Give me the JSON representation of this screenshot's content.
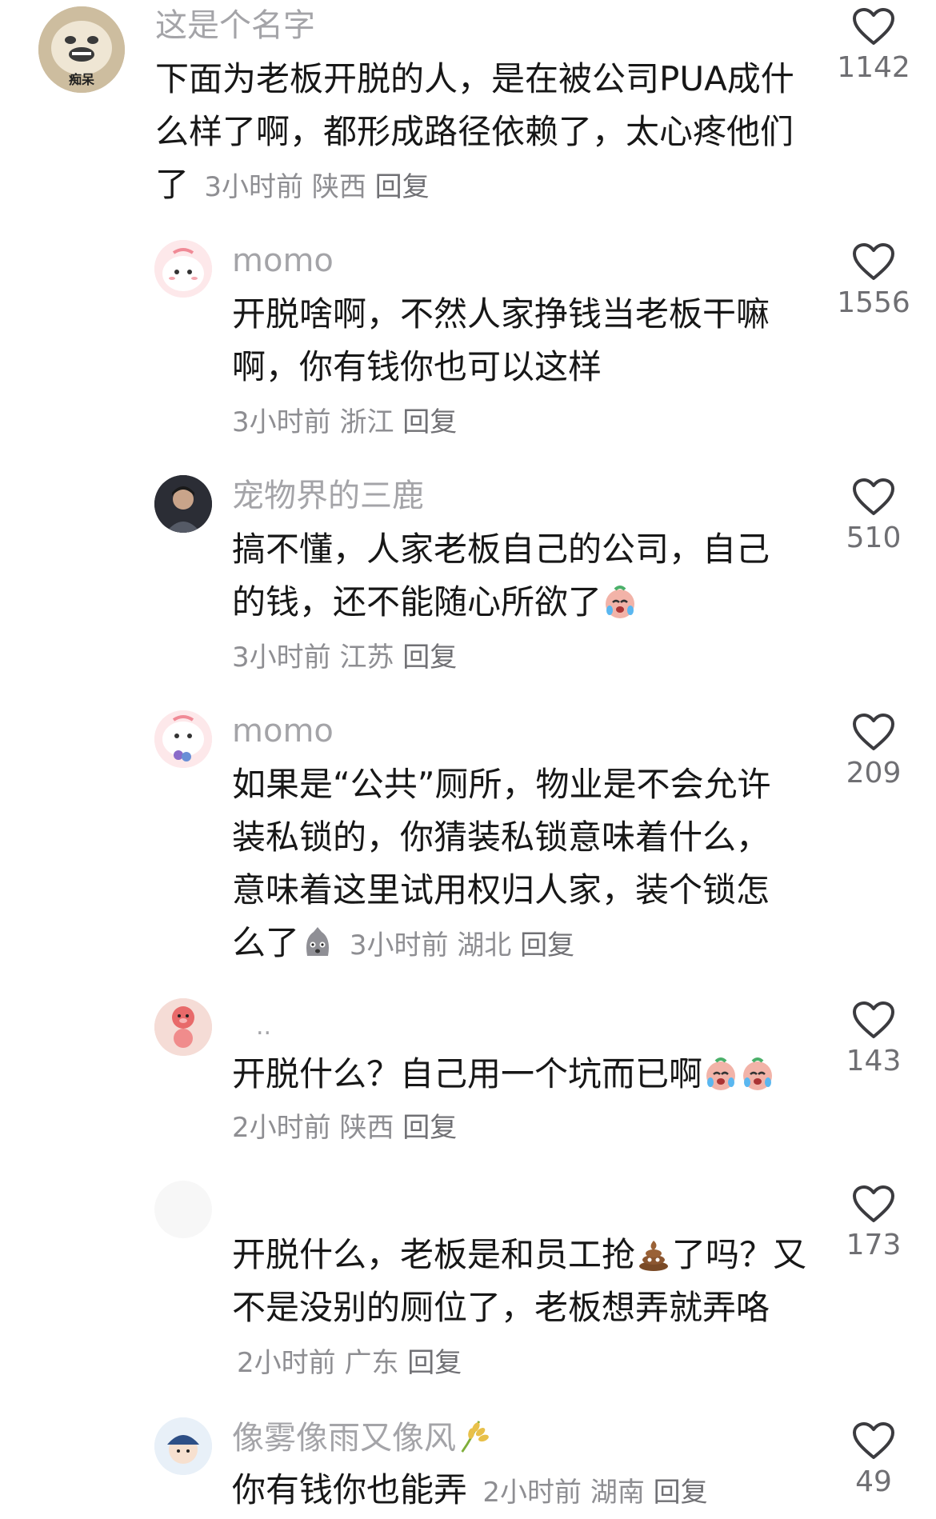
{
  "comments": [
    {
      "username": "这是个名字",
      "avatar_label": "痴呆",
      "text": "下面为老板开脱的人，是在被公司PUA成什么样了啊，都形成路径依赖了，太心疼他们了",
      "time": "3小时前",
      "location": "陕西",
      "reply": "回复",
      "likes": "1142"
    },
    {
      "username": "momo",
      "text": "开脱啥啊，不然人家挣钱当老板干嘛啊，你有钱你也可以这样",
      "time": "3小时前",
      "location": "浙江",
      "reply": "回复",
      "likes": "1556"
    },
    {
      "username": "宠物界的三鹿",
      "text": "搞不懂，人家老板自己的公司，自己的钱，还不能随心所欲了",
      "emoji": "crying-face",
      "time": "3小时前",
      "location": "江苏",
      "reply": "回复",
      "likes": "510"
    },
    {
      "username": "momo",
      "text": "如果是“公共”厕所，物业是不会允许装私锁的，你猜装私锁意味着什么，意味着这里试用权归人家，装个锁怎么了",
      "emoji": "sad-bag-face",
      "time": "3小时前",
      "location": "湖北",
      "reply": "回复",
      "likes": "209"
    },
    {
      "username": "..",
      "text": "开脱什么？自己用一个坑而已啊",
      "emoji": "crying-face x2",
      "time": "2小时前",
      "location": "陕西",
      "reply": "回复",
      "likes": "143"
    },
    {
      "username": "",
      "text_part1": "开脱什么，老板是和员工抢",
      "emoji": "poop",
      "text_part2": "了吗？又不是没别的厕位了，老板想弄就弄咯",
      "time": "2小时前",
      "location": "广东",
      "reply": "回复",
      "likes": "173"
    },
    {
      "username": "像雾像雨又像风",
      "username_emoji": "rice-ear",
      "text": "你有钱你也能弄",
      "time": "2小时前",
      "location": "湖南",
      "reply": "回复",
      "likes": "49"
    }
  ]
}
